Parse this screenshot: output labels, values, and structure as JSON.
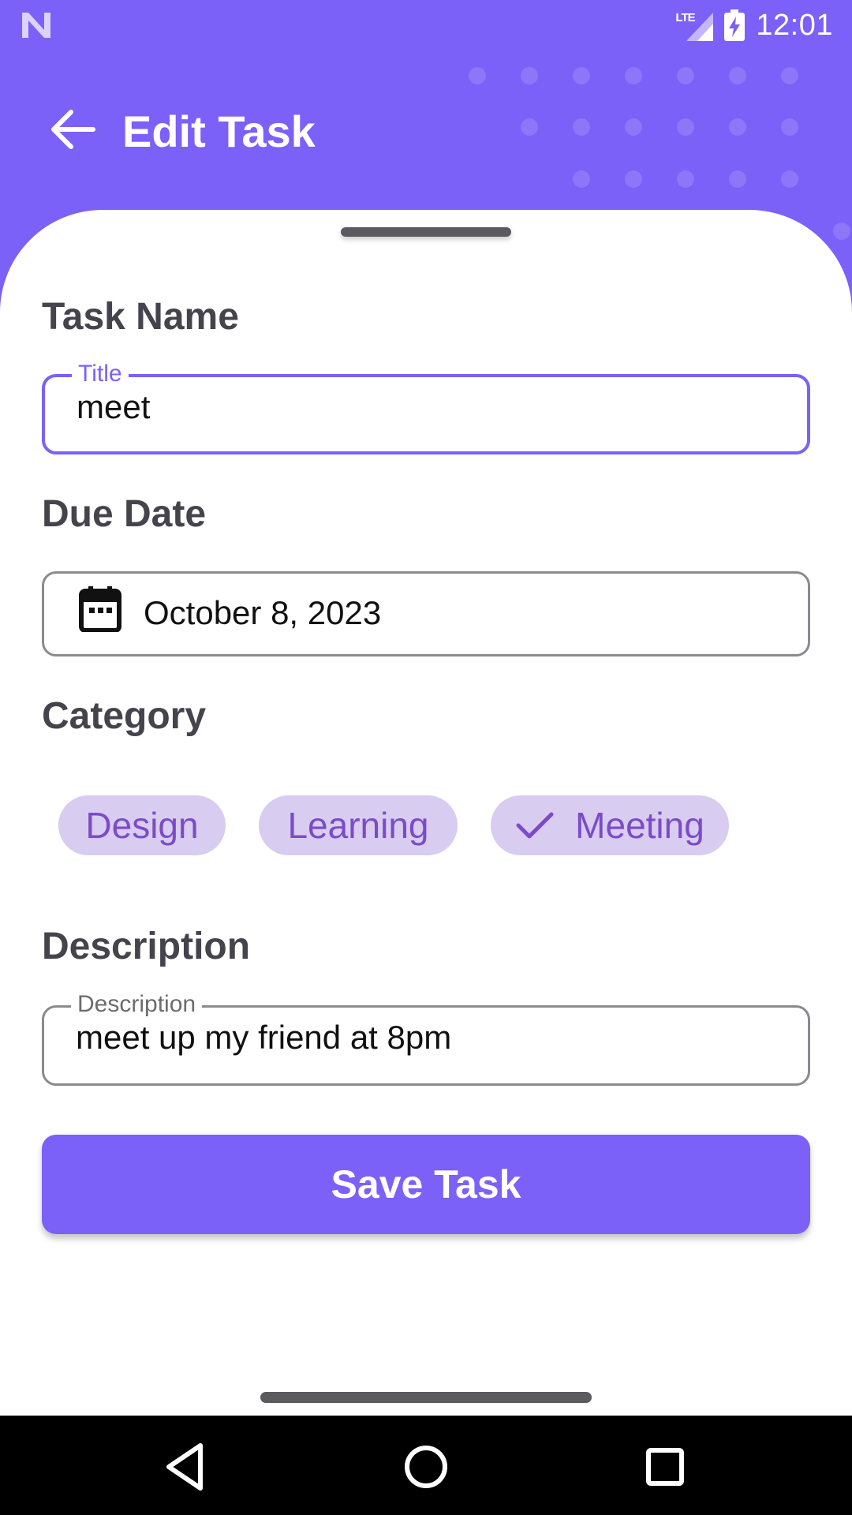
{
  "status_bar": {
    "network_label": "LTE",
    "time": "12:01"
  },
  "app_bar": {
    "back_icon": "arrow-left-icon",
    "title": "Edit Task"
  },
  "form": {
    "task_name": {
      "section_label": "Task Name",
      "field_label": "Title",
      "value": "meet"
    },
    "due_date": {
      "section_label": "Due Date",
      "icon": "calendar-icon",
      "value": "October 8, 2023"
    },
    "category": {
      "section_label": "Category",
      "chips": [
        {
          "label": "Design",
          "selected": false
        },
        {
          "label": "Learning",
          "selected": false
        },
        {
          "label": "Meeting",
          "selected": true
        }
      ]
    },
    "description": {
      "section_label": "Description",
      "field_label": "Description",
      "value": "meet up my friend at 8pm"
    },
    "save_label": "Save Task"
  },
  "colors": {
    "primary": "#7B61F8",
    "chip_background": "#D8CCF0",
    "chip_text": "#7B4BC8",
    "section_label": "#45434C"
  },
  "nav_bar": {
    "back_icon": "triangle-back-icon",
    "home_icon": "circle-home-icon",
    "recents_icon": "square-recents-icon"
  }
}
